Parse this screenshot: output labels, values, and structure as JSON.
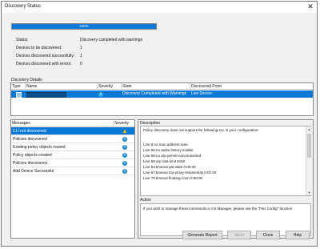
{
  "window": {
    "title": "Discovery Status"
  },
  "progress": {
    "value": 1.0,
    "text": "100%"
  },
  "summary": [
    {
      "label": "Status:",
      "value": "Discovery completed with warnings"
    },
    {
      "label": "Devices to be discovered:",
      "value": "1"
    },
    {
      "label": "Devices discovered successfully:",
      "value": "1"
    },
    {
      "label": "Devices discovered with errors:",
      "value": "0"
    }
  ],
  "details": {
    "section_label": "Discovery Details",
    "columns": [
      "Type",
      "Name",
      "Severity",
      "State",
      "Discovered From"
    ],
    "row": {
      "state": "Discovery Completed with Warnings",
      "from": "Live Device"
    }
  },
  "messages": {
    "columns": [
      "Messages",
      "Severity"
    ],
    "rows": [
      {
        "text": "CLI not discovered",
        "severity": "warning"
      },
      {
        "text": "Policies discovered",
        "severity": "info"
      },
      {
        "text": "Existing policy objects reused",
        "severity": "info"
      },
      {
        "text": "Policy objects created",
        "severity": "info"
      },
      {
        "text": "Policies discovered",
        "severity": "info"
      },
      {
        "text": "Add Device Successful",
        "severity": "info"
      }
    ]
  },
  "description": {
    "label": "Description",
    "lines": [
      "Policy discovery does not support the following CLI in your configuration:",
      "",
      "Line 6:no mac-address auto",
      "Line 56:no asdm history enable",
      "Line 58:no arp permit-nonconnected",
      "Line 59:arp rate-limit 8192",
      "Line 64:timeout pat-xlate 0:00:30",
      "Line 67:timeout tcp-proxy-reassembly 0:01:00",
      "Line 70:timeout floating-conn 0:00:00"
    ]
  },
  "action": {
    "label": "Action",
    "text": "If you wish to manage these commands in CS Manager, please use the \"Flex Config\" function"
  },
  "buttons": {
    "generate": "Generate Report",
    "abort": "Abort",
    "close": "Close",
    "help": "Help"
  },
  "colors": {
    "accent": "#0a78d7",
    "warning": "#f2b705",
    "info": "#1e8ad9"
  }
}
